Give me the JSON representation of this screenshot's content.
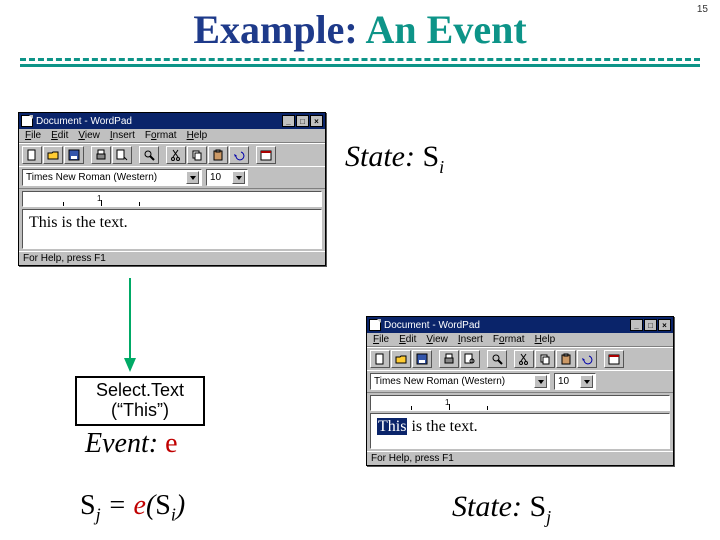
{
  "slide": {
    "number": "15",
    "title_a": "Example:",
    "title_b": "An Event"
  },
  "wordpad": {
    "title": "Document - WordPad",
    "menus": {
      "file": "File",
      "edit": "Edit",
      "view": "View",
      "insert": "Insert",
      "format": "Format",
      "help": "Help"
    },
    "font": "Times New Roman (Western)",
    "size": "10",
    "ruler_mark": "1",
    "status": "For Help, press F1",
    "body1": "This is the text.",
    "body2_sel": "This",
    "body2_rest": " is the text."
  },
  "labels": {
    "state_prefix": "State: ",
    "S": "S",
    "i": "i",
    "j": "j",
    "select_l1": "Select.Text",
    "select_l2": "(“This”)",
    "event_prefix": "Event: ",
    "e": "e",
    "eq_lhs": "S",
    "eq_mid": " = ",
    "eq_e": "e",
    "eq_open": "(",
    "eq_close": ")"
  }
}
